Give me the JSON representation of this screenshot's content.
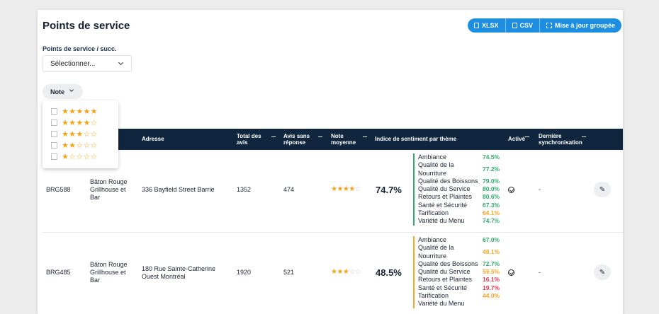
{
  "page": {
    "title": "Points de service"
  },
  "toolbar": {
    "xlsx": "XLSX",
    "csv": "CSV",
    "bulk_update": "Mise à jour groupée"
  },
  "filter": {
    "label": "Points de service / succ.",
    "select_value": "Sélectionner..."
  },
  "note_filter": {
    "label": "Note",
    "options": [
      {
        "stars": "★★★★★",
        "empty": ""
      },
      {
        "stars": "★★★★",
        "empty": "☆"
      },
      {
        "stars": "★★★",
        "empty": "☆☆"
      },
      {
        "stars": "★★",
        "empty": "☆☆☆"
      },
      {
        "stars": "★",
        "empty": "☆☆☆☆"
      }
    ]
  },
  "table": {
    "headers": {
      "address": "Adresse",
      "total_reviews_1": "Total des",
      "total_reviews_2": "avis",
      "unanswered_1": "Avis sans",
      "unanswered_2": "réponse",
      "avg_rating_1": "Note",
      "avg_rating_2": "moyenne",
      "sentiment": "Indice de sentiment par thème",
      "active": "Activé",
      "last_sync_1": "Dernière",
      "last_sync_2": "synchronisation"
    },
    "rows": [
      {
        "code": "BRG588",
        "name": "Bâton Rouge Grillhouse et Bar",
        "address": "336 Bayfield Street Barrie",
        "total": "1352",
        "unanswered": "474",
        "stars_on": "★★★★",
        "stars_off": "☆",
        "index": "74.7%",
        "sync": "-",
        "themes": [
          {
            "name": "Ambiance",
            "value": "74.5%",
            "color": "#2eaa6b"
          },
          {
            "name": "Qualité de la Nourriture",
            "value": "77.2%",
            "color": "#2eaa6b"
          },
          {
            "name": "Qualité des Boissons",
            "value": "79.0%",
            "color": "#2eaa6b"
          },
          {
            "name": "Qualité du Service",
            "value": "80.0%",
            "color": "#2eaa6b"
          },
          {
            "name": "Retours et Plaintes",
            "value": "80.6%",
            "color": "#2eaa6b"
          },
          {
            "name": "Santé et Sécurité",
            "value": "67.3%",
            "color": "#2eaa6b"
          },
          {
            "name": "Tarification",
            "value": "64.1%",
            "color": "#f5a623"
          },
          {
            "name": "Variété du Menu",
            "value": "74.7%",
            "color": "#2eaa6b"
          }
        ]
      },
      {
        "code": "BRG485",
        "name": "Bâton Rouge Grillhouse et Bar",
        "address": "180 Rue Sainte-Catherine Ouest Montréal",
        "total": "1920",
        "unanswered": "521",
        "stars_on": "★★★",
        "stars_off": "☆☆",
        "index": "48.5%",
        "sync": "-",
        "themes": [
          {
            "name": "Ambiance",
            "value": "67.0%",
            "color": "#2eaa6b"
          },
          {
            "name": "Qualité de la Nourriture",
            "value": "49.1%",
            "color": "#f5a623"
          },
          {
            "name": "Qualité des Boissons",
            "value": "72.7%",
            "color": "#2eaa6b"
          },
          {
            "name": "Qualité du Service",
            "value": "59.5%",
            "color": "#f5a623"
          },
          {
            "name": "Retours et Plaintes",
            "value": "16.1%",
            "color": "#e8344e"
          },
          {
            "name": "Santé et Sécurité",
            "value": "19.7%",
            "color": "#e8344e"
          },
          {
            "name": "Tarification",
            "value": "44.0%",
            "color": "#f5a623"
          },
          {
            "name": "Variété du Menu",
            "value": "",
            "color": "#f5a623"
          }
        ]
      }
    ]
  },
  "colors": {
    "accent": "#1e8fe0",
    "header_bg": "#10263f",
    "star": "#f3a31b",
    "positive": "#2eaa6b",
    "neutral": "#f5a623",
    "negative": "#e8344e"
  }
}
